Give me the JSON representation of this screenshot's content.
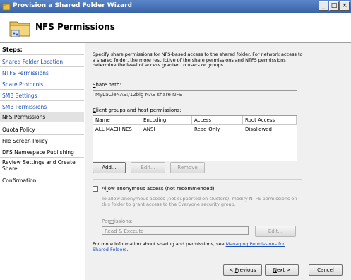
{
  "window": {
    "title": "Provision a Shared Folder Wizard",
    "minimize_glyph": "_",
    "maximize_glyph": "□",
    "close_glyph": "×"
  },
  "header": {
    "title": "NFS Permissions"
  },
  "steps": {
    "title": "Steps:",
    "items": [
      {
        "label": "Shared Folder Location"
      },
      {
        "label": "NTFS Permissions"
      },
      {
        "label": "Share Protocols"
      },
      {
        "label": "SMB Settings"
      },
      {
        "label": "SMB Permissions"
      },
      {
        "label": "NFS Permissions"
      },
      {
        "label": "Quota Policy"
      },
      {
        "label": "File Screen Policy"
      },
      {
        "label": "DFS Namespace Publishing"
      },
      {
        "label": "Review Settings and Create Share"
      },
      {
        "label": "Confirmation"
      }
    ]
  },
  "main": {
    "description": "Specify share permissions for NFS-based access to the shared folder. For network access to a shared folder, the more restrictive of the share permissions and NTFS permissions determine the level of access granted to users or groups.",
    "share_path_label": "Share path:",
    "share_path_value": "MyLaCieNAS:/12big NAS share NFS",
    "clients_label": "Client groups and host permissions:",
    "table": {
      "columns": [
        "Name",
        "Encoding",
        "Access",
        "Root Access"
      ],
      "rows": [
        [
          "ALL MACHINES",
          "ANSI",
          "Read-Only",
          "Disallowed"
        ]
      ]
    },
    "add_label": "Add...",
    "edit_label": "Edit...",
    "remove_label": "Remove",
    "anon_label": "Allow anonymous access (not recommended)",
    "anon_desc": "To allow anonymous access (not supported on clusters), modify NTFS permissions on this folder to grant access to the Everyone security group.",
    "permissions_label": "Permissions:",
    "permissions_value": "Read & Execute",
    "perm_edit_label": "Edit...",
    "more_info_text": "For more information about sharing and permissions, see",
    "more_info_link": "Managing Permissions for Shared Folders",
    "more_info_end": "."
  },
  "footer": {
    "previous_label": "< Previous",
    "next_label": "Next >",
    "cancel_label": "Cancel"
  }
}
